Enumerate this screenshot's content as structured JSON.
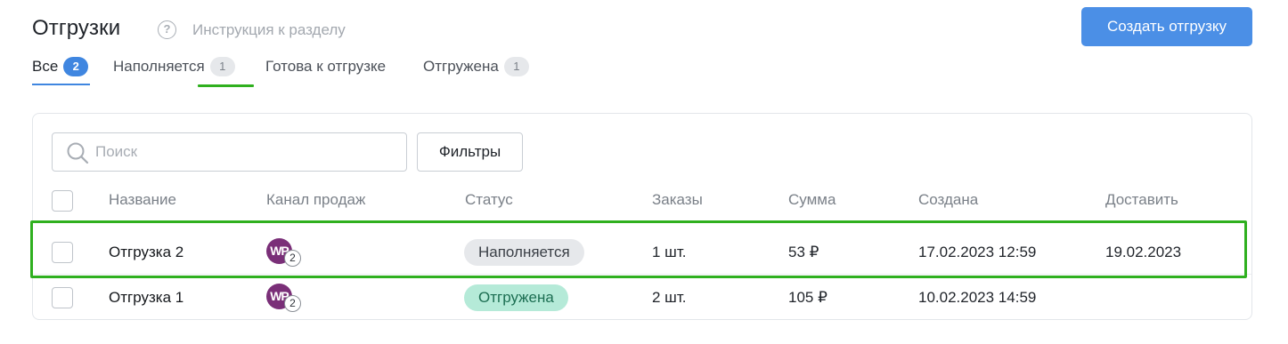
{
  "header": {
    "title": "Отгрузки",
    "help_icon": "question-circle-icon",
    "help_link": "Инструкция к разделу",
    "create_button": "Создать отгрузку"
  },
  "tabs": [
    {
      "label": "Все",
      "count": "2",
      "active": true
    },
    {
      "label": "Наполняется",
      "count": "1",
      "active": false
    },
    {
      "label": "Готова к отгрузке",
      "count": "",
      "active": false
    },
    {
      "label": "Отгружена",
      "count": "1",
      "active": false
    }
  ],
  "toolbar": {
    "search_icon": "search-icon",
    "search_placeholder": "Поиск",
    "filters_button": "Фильтры"
  },
  "table": {
    "columns": [
      "Название",
      "Канал продаж",
      "Статус",
      "Заказы",
      "Сумма",
      "Создана",
      "Доставить"
    ],
    "rows": [
      {
        "name": "Отгрузка 2",
        "channel_badge": "WP",
        "channel_count": "2",
        "status": "Наполняется",
        "status_color": "#e6e8eb",
        "orders": "1 шт.",
        "sum": "53 ₽",
        "created": "17.02.2023 12:59",
        "deliver": "19.02.2023"
      },
      {
        "name": "Отгрузка 1",
        "channel_badge": "WP",
        "channel_count": "2",
        "status": "Отгружена",
        "status_color": "#b5ead8",
        "orders": "2 шт.",
        "sum": "105 ₽",
        "created": "10.02.2023 14:59",
        "deliver": ""
      }
    ]
  },
  "colors": {
    "accent": "#4b8fe6",
    "highlight": "#2fb01f",
    "channel_brand": "#7a2f78"
  }
}
